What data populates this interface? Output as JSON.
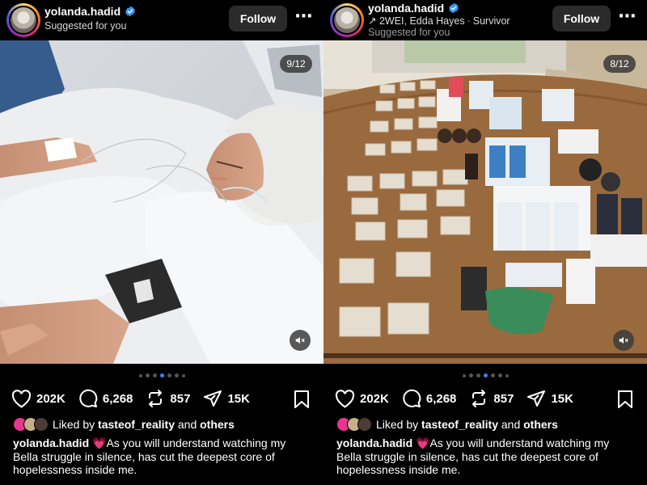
{
  "posts": [
    {
      "username": "yolanda.hadid",
      "subtitle": "Suggested for you",
      "follow_label": "Follow",
      "more_icon": "...",
      "counter": "9/12",
      "likes": "202K",
      "comments": "6,268",
      "reposts": "857",
      "shares": "15K",
      "liked_by_prefix": "Liked by",
      "liked_by_user": "tasteof_reality",
      "liked_by_and": "and",
      "liked_by_others": "others",
      "caption_user": "yolanda.hadid",
      "caption_emoji": "💗",
      "caption_text": "As you will understand watching my Bella struggle in silence, has cut the deepest core of hopelessness inside me."
    },
    {
      "username": "yolanda.hadid",
      "music": "2WEI, Edda Hayes",
      "music_dot": "·",
      "music_title": "Survivor",
      "subtitle": "Suggested for you",
      "follow_label": "Follow",
      "more_icon": "...",
      "counter": "8/12",
      "likes": "202K",
      "comments": "6,268",
      "reposts": "857",
      "shares": "15K",
      "liked_by_prefix": "Liked by",
      "liked_by_user": "tasteof_reality",
      "liked_by_and": "and",
      "liked_by_others": "others",
      "caption_user": "yolanda.hadid",
      "caption_emoji": "💗",
      "caption_text": "As you will understand watching my Bella struggle in silence, has cut the deepest core of hopelessness inside me."
    }
  ],
  "colors": {
    "background": "#000000",
    "follow_bg": "#2b2b2b",
    "verified": "#3897f0",
    "active_dot": "#3b82f6"
  },
  "icons": [
    "verified-badge-icon",
    "more-options-icon",
    "heart-icon",
    "comment-icon",
    "repost-icon",
    "share-icon",
    "bookmark-icon",
    "mute-icon",
    "music-note-icon"
  ]
}
